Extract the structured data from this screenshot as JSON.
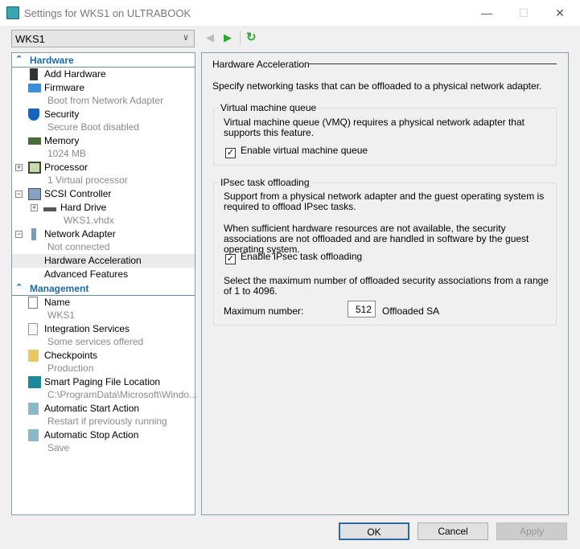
{
  "window": {
    "title": "Settings for WKS1 on ULTRABOOK"
  },
  "vm_select": {
    "value": "WKS1"
  },
  "tree": {
    "hardware_header": "Hardware",
    "hardware": [
      {
        "label": "Add Hardware",
        "icon": "add-hardware-icon"
      },
      {
        "label": "Firmware",
        "sub": "Boot from Network Adapter",
        "icon": "firmware-icon"
      },
      {
        "label": "Security",
        "sub": "Secure Boot disabled",
        "icon": "shield-icon"
      },
      {
        "label": "Memory",
        "sub": "1024 MB",
        "icon": "memory-icon"
      },
      {
        "label": "Processor",
        "sub": "1 Virtual processor",
        "icon": "processor-icon"
      },
      {
        "label": "SCSI Controller",
        "icon": "scsi-icon"
      },
      {
        "label": "Hard Drive",
        "sub": "WKS1.vhdx",
        "icon": "hard-drive-icon"
      },
      {
        "label": "Network Adapter",
        "sub": "Not connected",
        "icon": "network-adapter-icon"
      },
      {
        "label": "Hardware Acceleration"
      },
      {
        "label": "Advanced Features"
      }
    ],
    "management_header": "Management",
    "management": [
      {
        "label": "Name",
        "sub": "WKS1"
      },
      {
        "label": "Integration Services",
        "sub": "Some services offered"
      },
      {
        "label": "Checkpoints",
        "sub": "Production"
      },
      {
        "label": "Smart Paging File Location",
        "sub": "C:\\ProgramData\\Microsoft\\Windo..."
      },
      {
        "label": "Automatic Start Action",
        "sub": "Restart if previously running"
      },
      {
        "label": "Automatic Stop Action",
        "sub": "Save"
      }
    ]
  },
  "panel": {
    "title": "Hardware Acceleration",
    "description": "Specify networking tasks that can be offloaded to a physical network adapter.",
    "vmq": {
      "title": "Virtual machine queue",
      "text": "Virtual machine queue (VMQ) requires a physical network adapter that supports this feature.",
      "checkbox": "Enable virtual machine queue",
      "checked": true
    },
    "ipsec": {
      "title": "IPsec task offloading",
      "text1": "Support from a physical network adapter and the guest operating system is required to offload IPsec tasks.",
      "text2": "When sufficient hardware resources are not available, the security associations are not offloaded and are handled in software by the guest operating system.",
      "checkbox": "Enable IPsec task offloading",
      "checked": true,
      "range_text": "Select the maximum number of offloaded security associations from a range of 1 to 4096.",
      "max_label": "Maximum number:",
      "max_value": "512",
      "unit": "Offloaded SA"
    }
  },
  "buttons": {
    "ok": "OK",
    "cancel": "Cancel",
    "apply": "Apply"
  },
  "colors": {
    "accent": "#1e6aa5",
    "nav_green": "#2fa52f"
  }
}
